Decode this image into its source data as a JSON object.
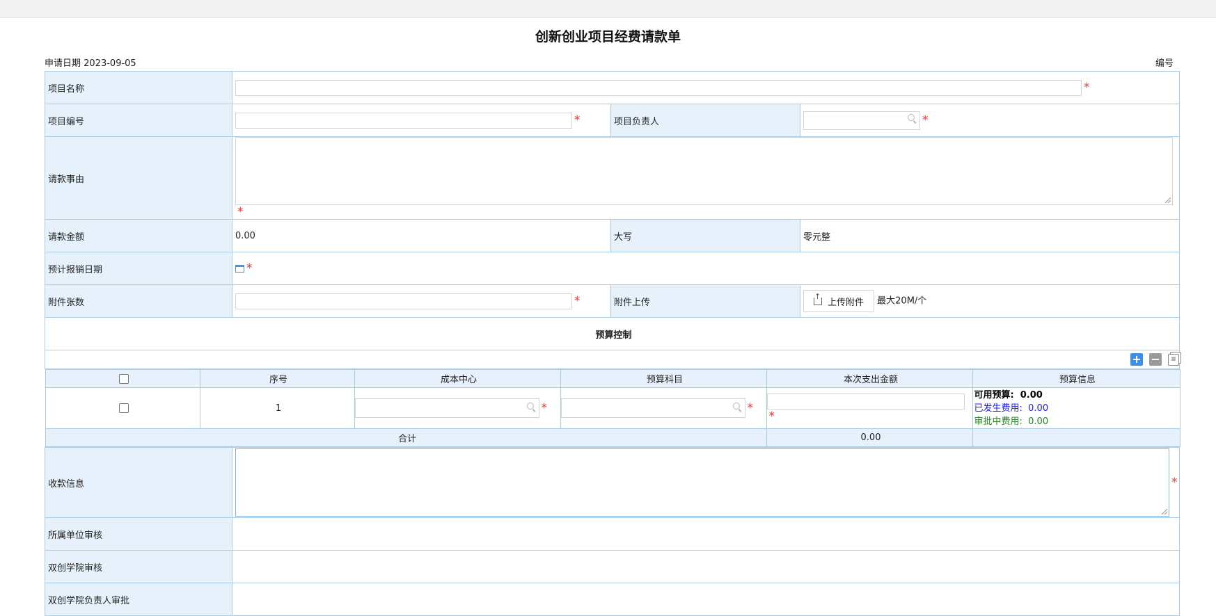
{
  "title": "创新创业项目经费请款单",
  "header": {
    "apply_date_label": "申请日期",
    "apply_date": "2023-09-05",
    "serial_label": "编号"
  },
  "fields": {
    "project_name": "项目名称",
    "project_no": "项目编号",
    "project_leader": "项目负责人",
    "reason": "请款事由",
    "amount_label": "请款金额",
    "amount_value": "0.00",
    "uppercase_label": "大写",
    "uppercase_value": "零元整",
    "expected_date": "预计报销日期",
    "attachment_count": "附件张数",
    "attachment_upload": "附件上传",
    "upload_button": "上传附件",
    "upload_hint": "最大20M/个"
  },
  "budget": {
    "section_title": "预算控制",
    "columns": [
      "序号",
      "成本中心",
      "预算科目",
      "本次支出金额",
      "预算信息"
    ],
    "rows": [
      {
        "index": "1",
        "available_label": "可用预算:",
        "available": "0.00",
        "incurred_label": "已发生费用:",
        "incurred": "0.00",
        "pending_label": "审批中费用:",
        "pending": "0.00"
      }
    ],
    "total_label": "合计",
    "total_value": "0.00"
  },
  "payee_info": "收款信息",
  "approvals": [
    "所属单位审核",
    "双创学院审核",
    "双创学院负责人审批"
  ],
  "icons": {
    "add": "plus-icon",
    "remove": "minus-icon",
    "copy": "copy-icon",
    "search": "search-icon",
    "calendar": "calendar-icon",
    "upload": "upload-icon"
  },
  "colors": {
    "label_bg": "#e6f1fb",
    "border": "#a9cbe6",
    "required": "#e53935",
    "incurred": "#1a1aff",
    "pending": "#1e8a1e",
    "add_button": "#3d8ee6"
  }
}
